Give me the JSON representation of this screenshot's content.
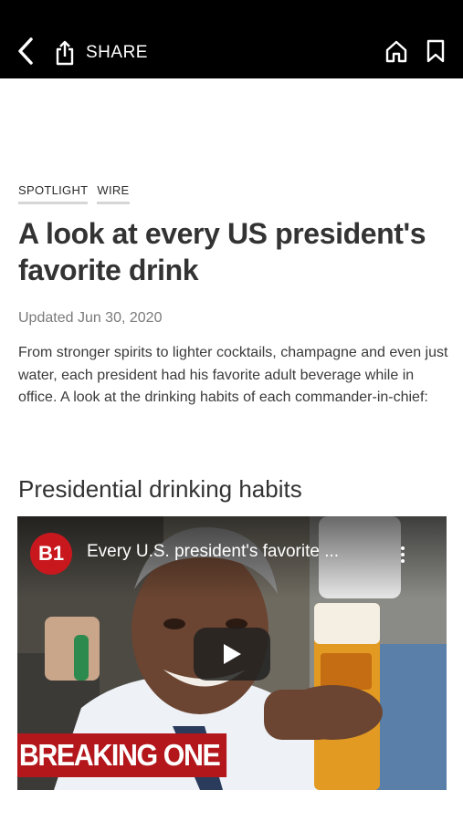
{
  "topbar": {
    "back_icon": "chevron-left-icon",
    "share_icon": "share-icon",
    "share_label": "SHARE",
    "home_icon": "home-icon",
    "bookmark_icon": "bookmark-icon"
  },
  "article": {
    "tags": [
      "SPOTLIGHT",
      "WIRE"
    ],
    "headline": "A look at every US president's favorite drink",
    "updated": "Updated Jun 30, 2020",
    "summary": "From stronger spirits to lighter cocktails, champagne and even just water, each president had his favorite adult beverage while in office. A look at the drinking habits of each commander-in-chief:",
    "section_title": "Presidential drinking habits"
  },
  "video": {
    "channel_logo": "B1",
    "title": "Every U.S. president's favorite ...",
    "more_icon": "more-vertical-icon",
    "play_icon": "play-icon",
    "overlay_banner": "BREAKING ONE",
    "colors": {
      "logo": "#c8181e",
      "banner": "#b3171c"
    }
  }
}
